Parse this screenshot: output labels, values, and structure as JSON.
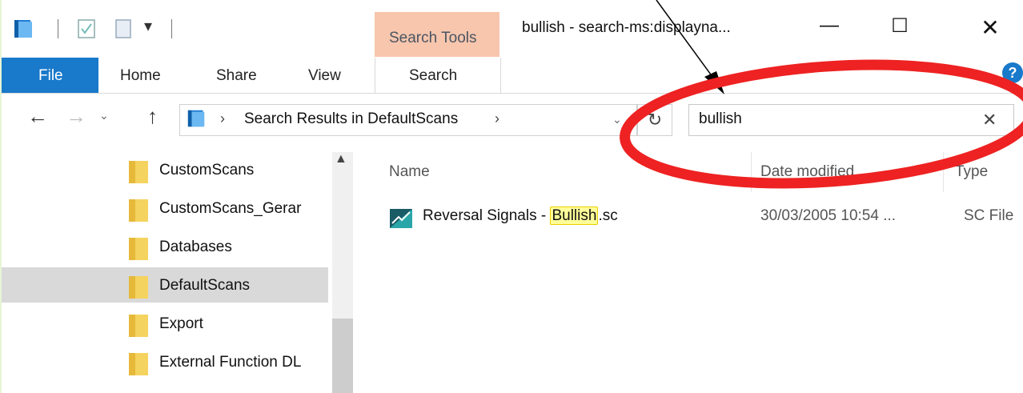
{
  "titlebar": {
    "title": "bullish - search-ms:displayna...",
    "contextual_tab": "Search Tools",
    "minimize": "—",
    "maximize": "☐",
    "close": "✕"
  },
  "ribbon": {
    "file": "File",
    "home": "Home",
    "share": "Share",
    "view": "View",
    "search": "Search",
    "help": "?"
  },
  "navbar": {
    "back": "←",
    "forward": "→",
    "recent": "⌄",
    "up": "↑",
    "address": "Search Results in DefaultScans",
    "address_chevron": "›",
    "refresh": "↻",
    "search_value": "bullish",
    "search_clear": "✕"
  },
  "nav_tree": [
    {
      "label": "CustomScans",
      "selected": false
    },
    {
      "label": "CustomScans_Gerar",
      "selected": false
    },
    {
      "label": "Databases",
      "selected": false
    },
    {
      "label": "DefaultScans",
      "selected": true
    },
    {
      "label": "Export",
      "selected": false
    },
    {
      "label": "External Function DL",
      "selected": false
    }
  ],
  "columns": {
    "name": "Name",
    "date": "Date modified",
    "type": "Type"
  },
  "files": [
    {
      "name_prefix": "Reversal Signals - ",
      "name_highlight": "Bullish",
      "name_suffix": ".sc",
      "date": "30/03/2005 10:54 ...",
      "type": "SC File"
    }
  ],
  "colors": {
    "file_tab": "#1979ca",
    "search_tools_tab": "#f7c6ad",
    "annotation_circle": "#ee2222",
    "highlight": "#ffff99"
  }
}
